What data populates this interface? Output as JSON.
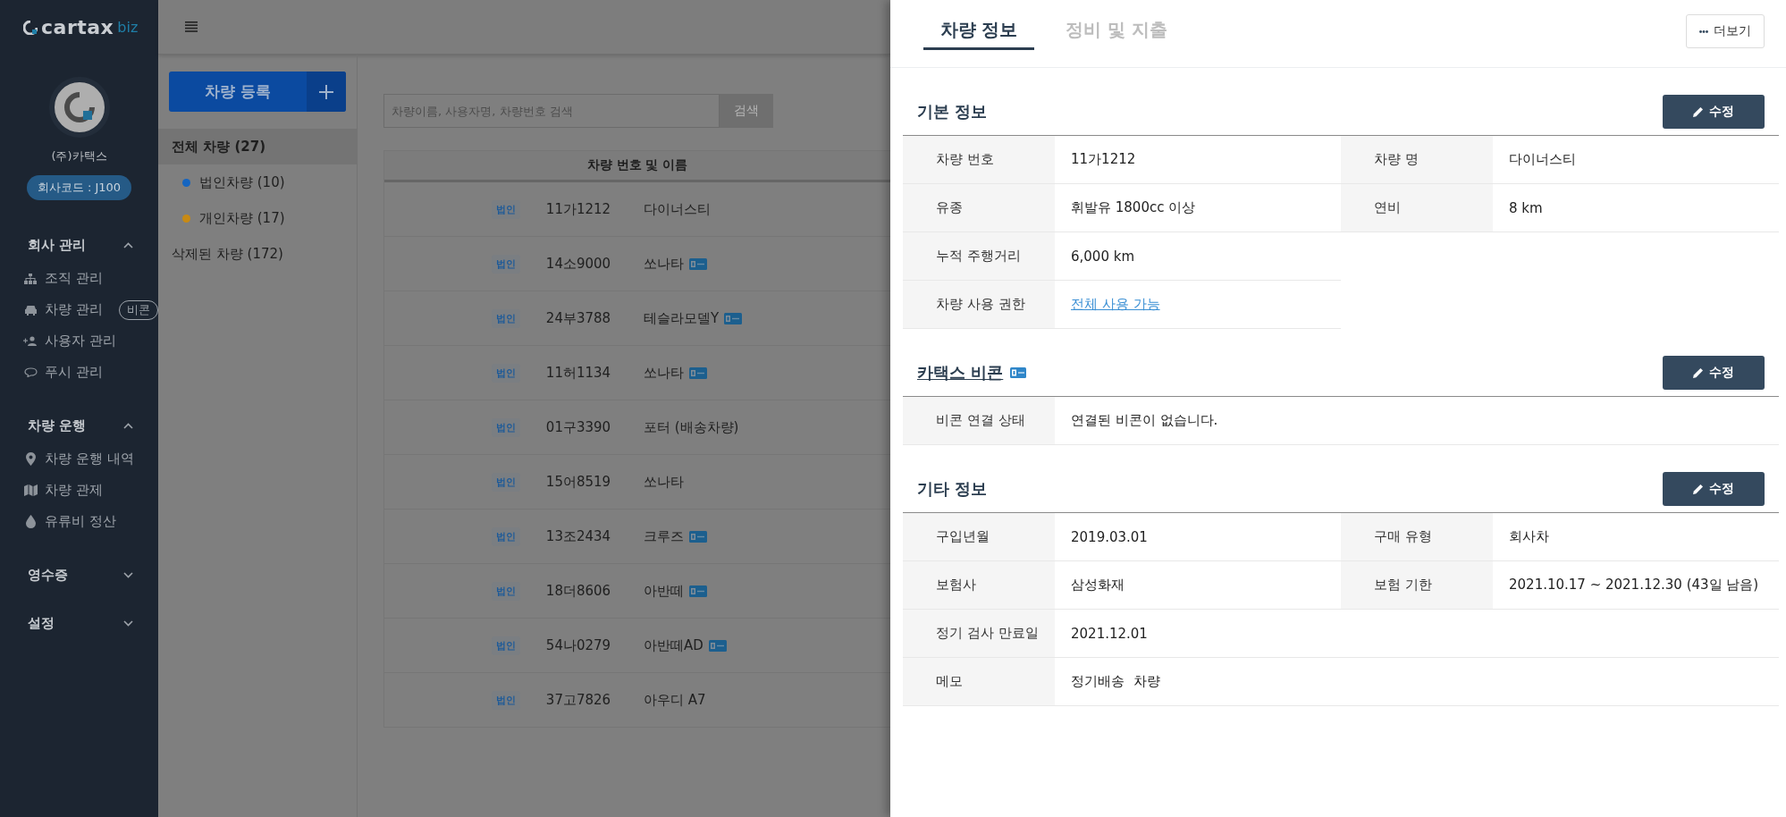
{
  "sidebar": {
    "logo": {
      "text": "cartax",
      "suffix": "biz"
    },
    "company": "(주)카택스",
    "company_code": "회사코드 : J100",
    "groups": [
      {
        "title": "회사 관리",
        "expanded": true,
        "items": [
          {
            "label": "조직 관리"
          },
          {
            "label": "차량 관리",
            "badge": "비콘"
          },
          {
            "label": "사용자 관리"
          },
          {
            "label": "푸시 관리"
          }
        ]
      },
      {
        "title": "차량 운행",
        "expanded": true,
        "items": [
          {
            "label": "차량 운행 내역"
          },
          {
            "label": "차량 관제"
          },
          {
            "label": "유류비 정산"
          }
        ]
      },
      {
        "title": "영수증",
        "expanded": false
      },
      {
        "title": "설정",
        "expanded": false
      }
    ]
  },
  "register_button": "차량 등록",
  "categories": [
    {
      "label": "전체 차량 (27)",
      "selected": true,
      "children": [
        {
          "label": "법인차량 (10)",
          "selected": false,
          "color": "#1565c0"
        },
        {
          "label": "개인차량 (17)",
          "selected": false,
          "color": "#c88a14"
        }
      ]
    },
    {
      "label": "삭제된 차량 (172)",
      "selected": false
    }
  ],
  "search": {
    "placeholder": "차량이름, 사용자명, 차량번호 검색",
    "button": "검색"
  },
  "table": {
    "columns": [
      "차량 번호 및 이름"
    ],
    "rows": [
      {
        "type": "법인",
        "number": "11가1212",
        "name": "다이너스티",
        "beacon": false
      },
      {
        "type": "법인",
        "number": "14소9000",
        "name": "쏘나타",
        "beacon": true
      },
      {
        "type": "법인",
        "number": "24부3788",
        "name": "테슬라모델Y",
        "beacon": true
      },
      {
        "type": "법인",
        "number": "11허1134",
        "name": "쏘나타",
        "beacon": true
      },
      {
        "type": "법인",
        "number": "01구3390",
        "name": "포터 (배송차량)",
        "beacon": false
      },
      {
        "type": "법인",
        "number": "15어8519",
        "name": "쏘나타",
        "beacon": false
      },
      {
        "type": "법인",
        "number": "13조2434",
        "name": "크루즈",
        "beacon": true
      },
      {
        "type": "법인",
        "number": "18더8606",
        "name": "아반떼",
        "beacon": true
      },
      {
        "type": "법인",
        "number": "54나0279",
        "name": "아반떼AD",
        "beacon": true
      },
      {
        "type": "법인",
        "number": "37고7826",
        "name": "아우디 A7",
        "beacon": false
      }
    ]
  },
  "drawer": {
    "tabs": [
      {
        "label": "차량 정보",
        "selected": true
      },
      {
        "label": "정비 및 지출",
        "selected": false
      }
    ],
    "more_button": "더보기",
    "sections": [
      {
        "title": "기본 정보",
        "title_link": false,
        "beacon": false,
        "edit_button": "수정",
        "rows": [
          {
            "fields": [
              {
                "label": "차량 번호",
                "value": "11가1212"
              },
              {
                "label": "차량 명",
                "value": "다이너스티"
              }
            ]
          },
          {
            "fields": [
              {
                "label": "유종",
                "value": "휘발유 1800cc 이상"
              },
              {
                "label": "연비",
                "value": "8 km"
              }
            ]
          },
          {
            "wide": false,
            "fields": [
              {
                "label": "누적 주행거리",
                "value": "6,000 km"
              }
            ]
          },
          {
            "wide": false,
            "fields": [
              {
                "label": "차량 사용 권한",
                "value": "전체 사용 가능",
                "link": true
              }
            ]
          }
        ]
      },
      {
        "title": "카택스 비콘",
        "title_link": true,
        "beacon": true,
        "edit_button": "수정",
        "rows": [
          {
            "wide": true,
            "fields": [
              {
                "label": "비콘 연결 상태",
                "value": "연결된 비콘이 없습니다."
              }
            ]
          }
        ]
      },
      {
        "title": "기타 정보",
        "title_link": false,
        "beacon": false,
        "edit_button": "수정",
        "rows": [
          {
            "fields": [
              {
                "label": "구입년월",
                "value": "2019.03.01"
              },
              {
                "label": "구매 유형",
                "value": "회사차"
              }
            ]
          },
          {
            "fields": [
              {
                "label": "보험사",
                "value": "삼성화재"
              },
              {
                "label": "보험 기한",
                "value": "2021.10.17 ~ 2021.12.30 (43일 남음)"
              }
            ]
          },
          {
            "wide": true,
            "fields": [
              {
                "label": "정기 검사 만료일",
                "value": "2021.12.01"
              }
            ]
          },
          {
            "wide": true,
            "fields": [
              {
                "label": "메모",
                "value": "정기배송  차량"
              }
            ]
          }
        ]
      }
    ]
  }
}
